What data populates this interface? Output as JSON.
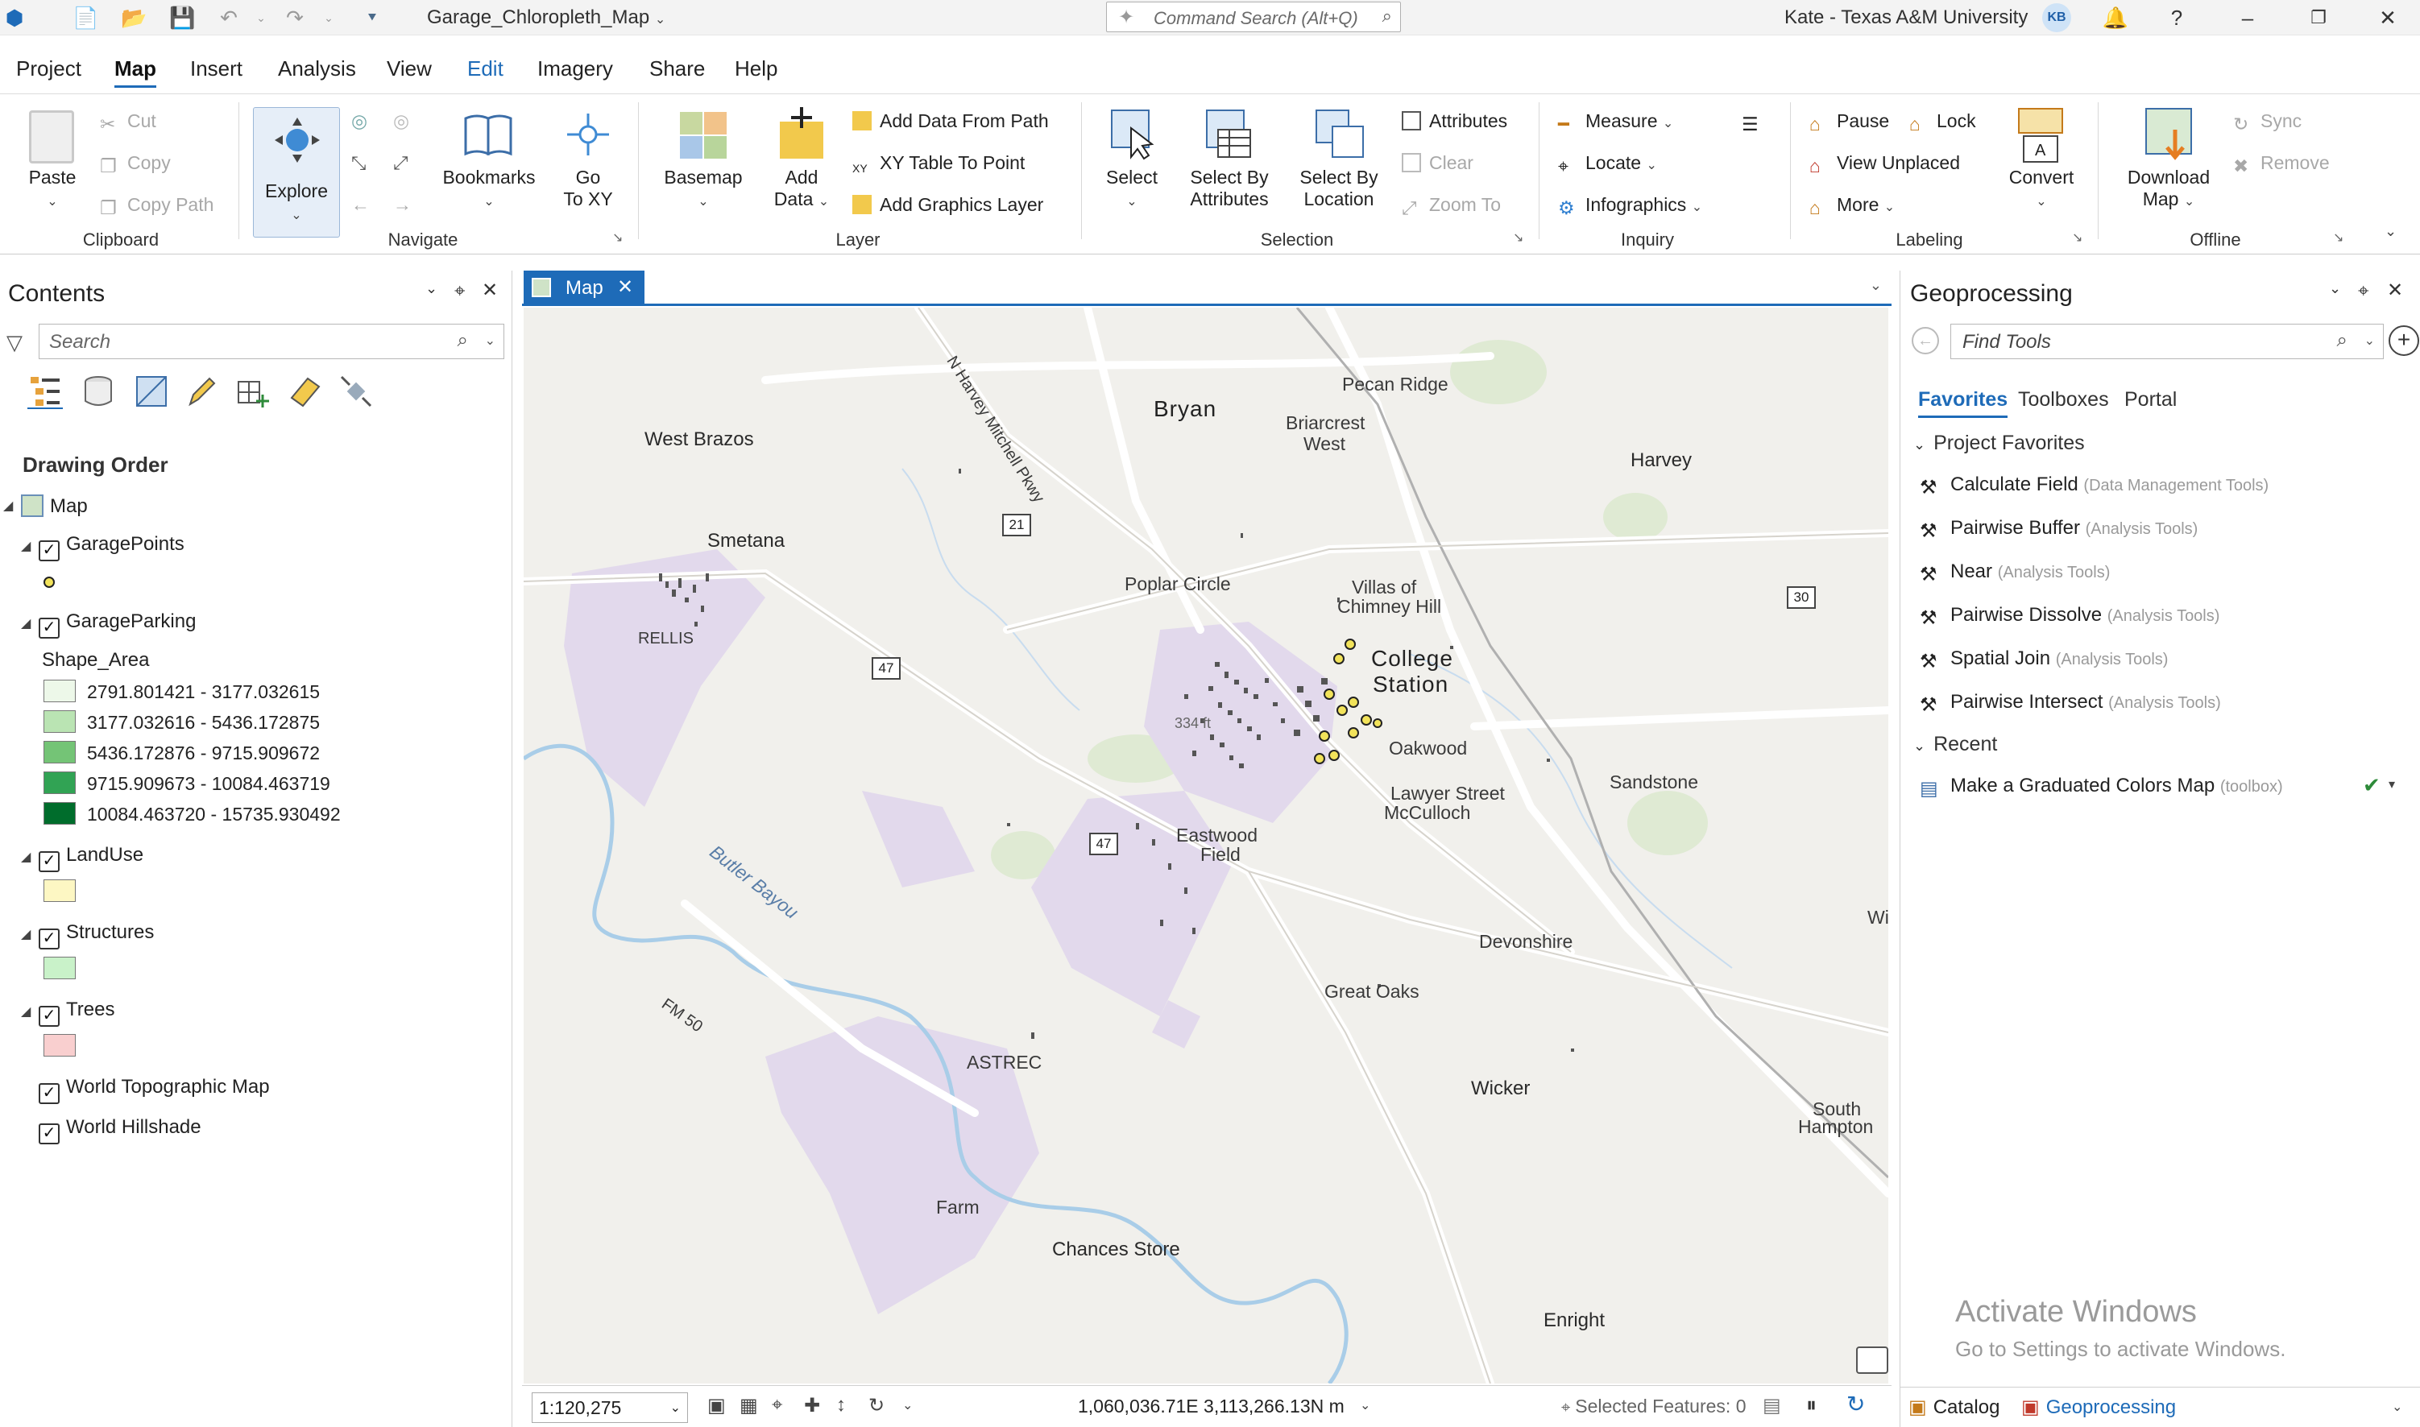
{
  "titlebar": {
    "document_title": "Garage_Chloropleth_Map",
    "command_search_placeholder": "Command Search (Alt+Q)",
    "user": "Kate - Texas A&M University",
    "avatar_initials": "KB"
  },
  "menu": [
    "Project",
    "Map",
    "Insert",
    "Analysis",
    "View",
    "Edit",
    "Imagery",
    "Share",
    "Help"
  ],
  "ribbon": {
    "clipboard": {
      "label": "Clipboard",
      "paste": "Paste",
      "cut": "Cut",
      "copy": "Copy",
      "copy_path": "Copy Path"
    },
    "navigate": {
      "label": "Navigate",
      "explore": "Explore",
      "bookmarks": "Bookmarks",
      "go_to_xy_1": "Go",
      "go_to_xy_2": "To XY"
    },
    "layer": {
      "label": "Layer",
      "basemap": "Basemap",
      "add_data_1": "Add",
      "add_data_2": "Data",
      "add_data_from_path": "Add Data From Path",
      "xy_table_to_point": "XY Table To Point",
      "add_graphics_layer": "Add Graphics Layer"
    },
    "selection": {
      "label": "Selection",
      "select": "Select",
      "select_by_attr_1": "Select By",
      "select_by_attr_2": "Attributes",
      "select_by_loc_1": "Select By",
      "select_by_loc_2": "Location",
      "attributes": "Attributes",
      "clear": "Clear",
      "zoom_to": "Zoom To"
    },
    "inquiry": {
      "label": "Inquiry",
      "measure": "Measure",
      "locate": "Locate",
      "infographics": "Infographics"
    },
    "labeling": {
      "label": "Labeling",
      "pause": "Pause",
      "lock": "Lock",
      "view_unplaced": "View Unplaced",
      "more": "More",
      "convert": "Convert"
    },
    "offline": {
      "label": "Offline",
      "download_1": "Download",
      "download_2": "Map",
      "sync": "Sync",
      "remove": "Remove"
    }
  },
  "contents": {
    "title": "Contents",
    "search_placeholder": "Search",
    "drawing_order": "Drawing Order",
    "map": "Map",
    "layers": {
      "garage_points": "GaragePoints",
      "garage_parking": "GarageParking",
      "shape_area": "Shape_Area",
      "landuse": "LandUse",
      "structures": "Structures",
      "trees": "Trees",
      "world_topo": "World Topographic Map",
      "world_hillshade": "World Hillshade"
    },
    "legend": [
      {
        "label": "2791.801421 - 3177.032615",
        "color": "#edf8e9"
      },
      {
        "label": "3177.032616 - 5436.172875",
        "color": "#bae4b3"
      },
      {
        "label": "5436.172876 - 9715.909672",
        "color": "#74c476"
      },
      {
        "label": "9715.909673 - 10084.463719",
        "color": "#31a354"
      },
      {
        "label": "10084.463720 - 15735.930492",
        "color": "#006d2c"
      }
    ],
    "landuse_color": "#fdf7c3",
    "structures_color": "#c9f2c9",
    "trees_color": "#f9cfcf"
  },
  "map_tab": "Map",
  "map_labels": {
    "bryan": "Bryan",
    "pecan_ridge": "Pecan Ridge",
    "briarcrest": "Briarcrest",
    "briarcrest2": "West",
    "west_brazos": "West Brazos",
    "harvey": "Harvey",
    "smetana": "Smetana",
    "rellis": "RELLIS",
    "poplar_circle": "Poplar Circle",
    "villas1": "Villas of",
    "villas2": "Chimney Hill",
    "college1": "College",
    "college2": "Station",
    "oakwood": "Oakwood",
    "sandstone": "Sandstone",
    "lawyer_street": "Lawyer Street",
    "mcculloch": "McCulloch",
    "eastwood1": "Eastwood",
    "eastwood2": "Field",
    "butler_bayou": "Butler Bayou",
    "devonshire": "Devonshire",
    "great_oaks": "Great Oaks",
    "fm50": "FM 50",
    "astrec": "ASTREC",
    "wicker": "Wicker",
    "south_hampton1": "South",
    "south_hampton2": "Hampton",
    "farm": "Farm",
    "chances_store": "Chances Store",
    "enrighte": "Enright",
    "harvey_mitchell": "N Harvey Mitchell Pkwy",
    "r21": "21",
    "r47a": "47",
    "r47b": "47",
    "r30": "30",
    "ft": "334 ft",
    "wi": "Wi"
  },
  "status": {
    "scale": "1:120,275",
    "coordinates": "1,060,036.71E 3,113,266.13N m",
    "selected_features": "Selected Features: 0"
  },
  "geoprocessing": {
    "title": "Geoprocessing",
    "search_placeholder": "Find Tools",
    "tabs": [
      "Favorites",
      "Toolboxes",
      "Portal"
    ],
    "project_favorites": "Project Favorites",
    "favorites": [
      {
        "name": "Calculate Field",
        "toolbox": "(Data Management Tools)"
      },
      {
        "name": "Pairwise Buffer",
        "toolbox": "(Analysis Tools)"
      },
      {
        "name": "Near",
        "toolbox": "(Analysis Tools)"
      },
      {
        "name": "Pairwise Dissolve",
        "toolbox": "(Analysis Tools)"
      },
      {
        "name": "Spatial Join",
        "toolbox": "(Analysis Tools)"
      },
      {
        "name": "Pairwise Intersect",
        "toolbox": "(Analysis Tools)"
      }
    ],
    "recent": "Recent",
    "recent_items": [
      {
        "name": "Make a Graduated Colors Map",
        "toolbox": "(toolbox)"
      }
    ],
    "activate_title": "Activate Windows",
    "activate_sub": "Go to Settings to activate Windows.",
    "bottom_tabs": [
      "Catalog",
      "Geoprocessing"
    ]
  },
  "colors": {
    "accent": "#1e6bb8",
    "campus": "#e2d9ec",
    "water": "#a9cde8",
    "park": "#d8e8c8"
  }
}
